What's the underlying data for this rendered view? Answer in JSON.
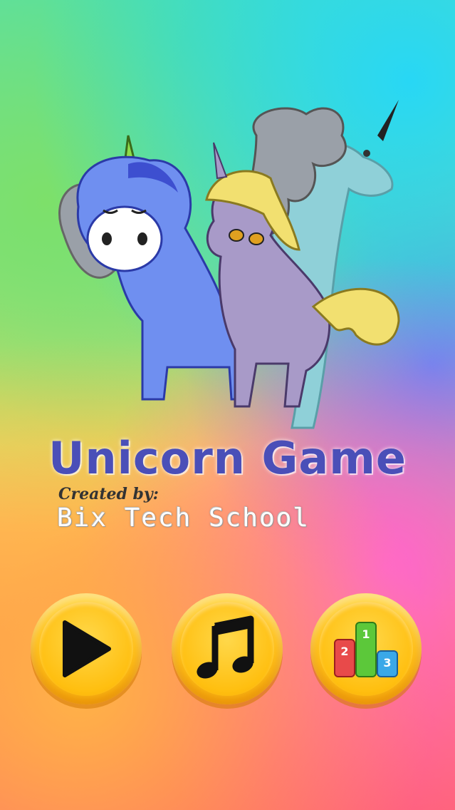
{
  "title": "Unicorn Game",
  "credits": {
    "label": "Created by:",
    "author": "Bix Tech School"
  },
  "buttons": {
    "play": "play-icon",
    "music": "music-note-icon",
    "leaderboard": "podium-icon"
  },
  "podium": [
    "1",
    "2",
    "3"
  ]
}
